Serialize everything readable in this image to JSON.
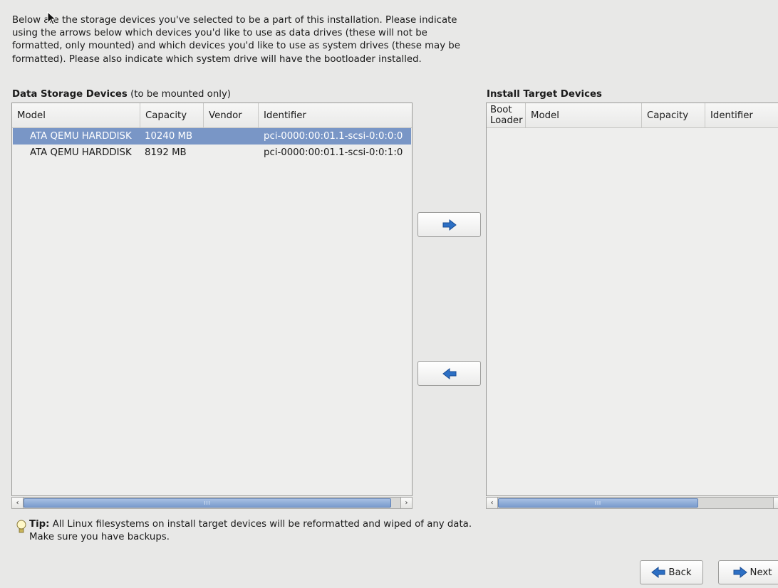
{
  "intro_text": "Below are the storage devices you've selected to be a part of this installation.  Please indicate using the arrows below which devices you'd like to use as data drives (these will not be formatted, only mounted) and which devices you'd like to use as system drives (these may be formatted).  Please also indicate which system drive will have the bootloader installed.",
  "data_storage": {
    "title": "Data Storage Devices",
    "subtitle": " (to be mounted only)",
    "columns": [
      "Model",
      "Capacity",
      "Vendor",
      "Identifier"
    ],
    "rows": [
      {
        "model": "ATA QEMU HARDDISK",
        "capacity": "10240 MB",
        "vendor": "",
        "identifier": "pci-0000:00:01.1-scsi-0:0:0:0",
        "selected": true
      },
      {
        "model": "ATA QEMU HARDDISK",
        "capacity": "8192 MB",
        "vendor": "",
        "identifier": "pci-0000:00:01.1-scsi-0:0:1:0",
        "selected": false
      }
    ]
  },
  "install_target": {
    "title": "Install Target Devices",
    "columns": [
      "Boot\nLoader",
      "Model",
      "Capacity",
      "Identifier"
    ],
    "rows": []
  },
  "buttons": {
    "add_icon": "arrow-right-icon",
    "remove_icon": "arrow-left-icon",
    "back_label": "Back",
    "next_label": "Next"
  },
  "scrollbar_glyphs": {
    "left": "‹",
    "right": "›",
    "grip": "III"
  },
  "tip": {
    "bold": "Tip:",
    "text": " All Linux filesystems on install target devices will be reformatted and wiped of any data.  Make sure you have backups."
  },
  "colors": {
    "selection": "#7996c6",
    "arrow_blue": "#2c6fc4"
  }
}
